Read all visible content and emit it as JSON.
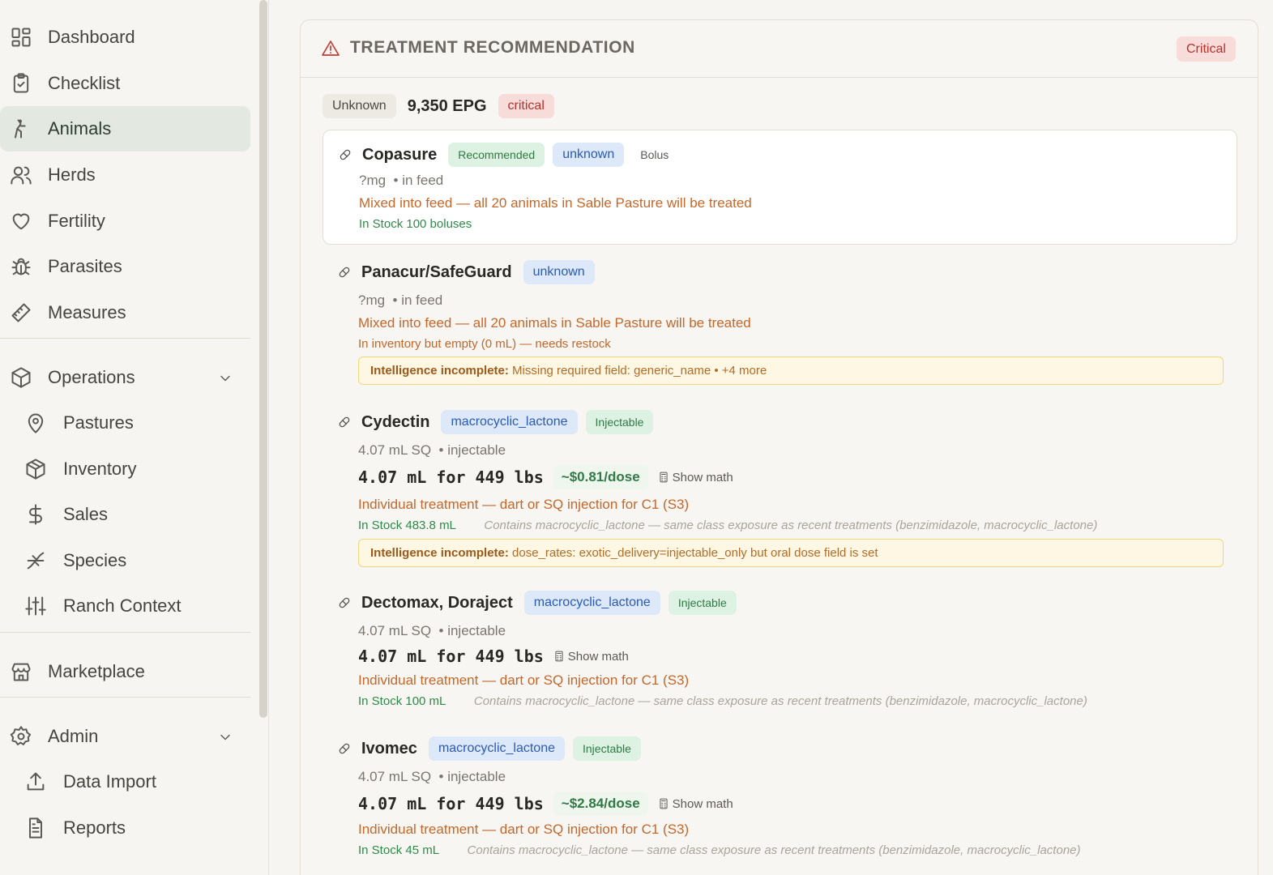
{
  "sidebar": {
    "items": [
      {
        "label": "Dashboard",
        "icon": "dashboard-icon"
      },
      {
        "label": "Checklist",
        "icon": "clipboard-check-icon"
      },
      {
        "label": "Animals",
        "icon": "animal-icon",
        "active": true
      },
      {
        "label": "Herds",
        "icon": "users-icon"
      },
      {
        "label": "Fertility",
        "icon": "heart-icon"
      },
      {
        "label": "Parasites",
        "icon": "bug-icon"
      },
      {
        "label": "Measures",
        "icon": "ruler-icon"
      }
    ],
    "operations": {
      "label": "Operations",
      "items": [
        {
          "label": "Pastures",
          "icon": "map-pin-icon"
        },
        {
          "label": "Inventory",
          "icon": "box-icon"
        },
        {
          "label": "Sales",
          "icon": "dollar-icon"
        },
        {
          "label": "Species",
          "icon": "dna-icon"
        },
        {
          "label": "Ranch Context",
          "icon": "sliders-icon"
        }
      ]
    },
    "marketplace": "Marketplace",
    "admin": {
      "label": "Admin",
      "items": [
        {
          "label": "Data Import",
          "icon": "upload-icon"
        },
        {
          "label": "Reports",
          "icon": "file-text-icon"
        }
      ]
    }
  },
  "panel": {
    "title": "TREATMENT RECOMMENDATION",
    "severity": "Critical",
    "summary": {
      "status": "Unknown",
      "epg": "9,350 EPG",
      "level": "critical"
    }
  },
  "drugs": [
    {
      "name": "Copasure",
      "tags": [
        "Recommended",
        "unknown",
        "Bolus"
      ],
      "dose": "?mg  • in feed",
      "treatment": "Mixed into feed — all 20 animals in Sable Pasture will be treated",
      "stock": "In Stock 100 boluses"
    },
    {
      "name": "Panacur/SafeGuard",
      "tags": [
        "unknown"
      ],
      "dose": "?mg  • in feed",
      "treatment": "Mixed into feed — all 20 animals in Sable Pasture will be treated",
      "stock_warning": "In inventory but empty (0 mL) — needs restock",
      "alert_label": "Intelligence incomplete:",
      "alert_text": "Missing required field: generic_name • +4 more"
    },
    {
      "name": "Cydectin",
      "tags": [
        "macrocyclic_lactone",
        "Injectable"
      ],
      "dose": "4.07 mL SQ  • injectable",
      "calc": "4.07 mL for 449 lbs",
      "price": "~$0.81/dose",
      "show_math": "Show math",
      "treatment": "Individual treatment — dart or SQ injection for C1 (S3)",
      "stock": "In Stock 483.8 mL",
      "note": "Contains macrocyclic_lactone — same class exposure as recent treatments (benzimidazole, macrocyclic_lactone)",
      "alert_label": "Intelligence incomplete:",
      "alert_text": "dose_rates: exotic_delivery=injectable_only but oral dose field is set"
    },
    {
      "name": "Dectomax, Doraject",
      "tags": [
        "macrocyclic_lactone",
        "Injectable"
      ],
      "dose": "4.07 mL SQ  • injectable",
      "calc": "4.07 mL for 449 lbs",
      "show_math": "Show math",
      "treatment": "Individual treatment — dart or SQ injection for C1 (S3)",
      "stock": "In Stock 100 mL",
      "note": "Contains macrocyclic_lactone — same class exposure as recent treatments (benzimidazole, macrocyclic_lactone)"
    },
    {
      "name": "Ivomec",
      "tags": [
        "macrocyclic_lactone",
        "Injectable"
      ],
      "dose": "4.07 mL SQ  • injectable",
      "calc": "4.07 mL for 449 lbs",
      "price": "~$2.84/dose",
      "show_math": "Show math",
      "treatment": "Individual treatment — dart or SQ injection for C1 (S3)",
      "stock": "In Stock 45 mL",
      "note": "Contains macrocyclic_lactone — same class exposure as recent treatments (benzimidazole, macrocyclic_lactone)"
    }
  ],
  "colors": {
    "accent_green": "#2f8a4a",
    "critical_red": "#b8322c",
    "warning_orange": "#c4672a",
    "active_nav": "#e3e8e1"
  }
}
